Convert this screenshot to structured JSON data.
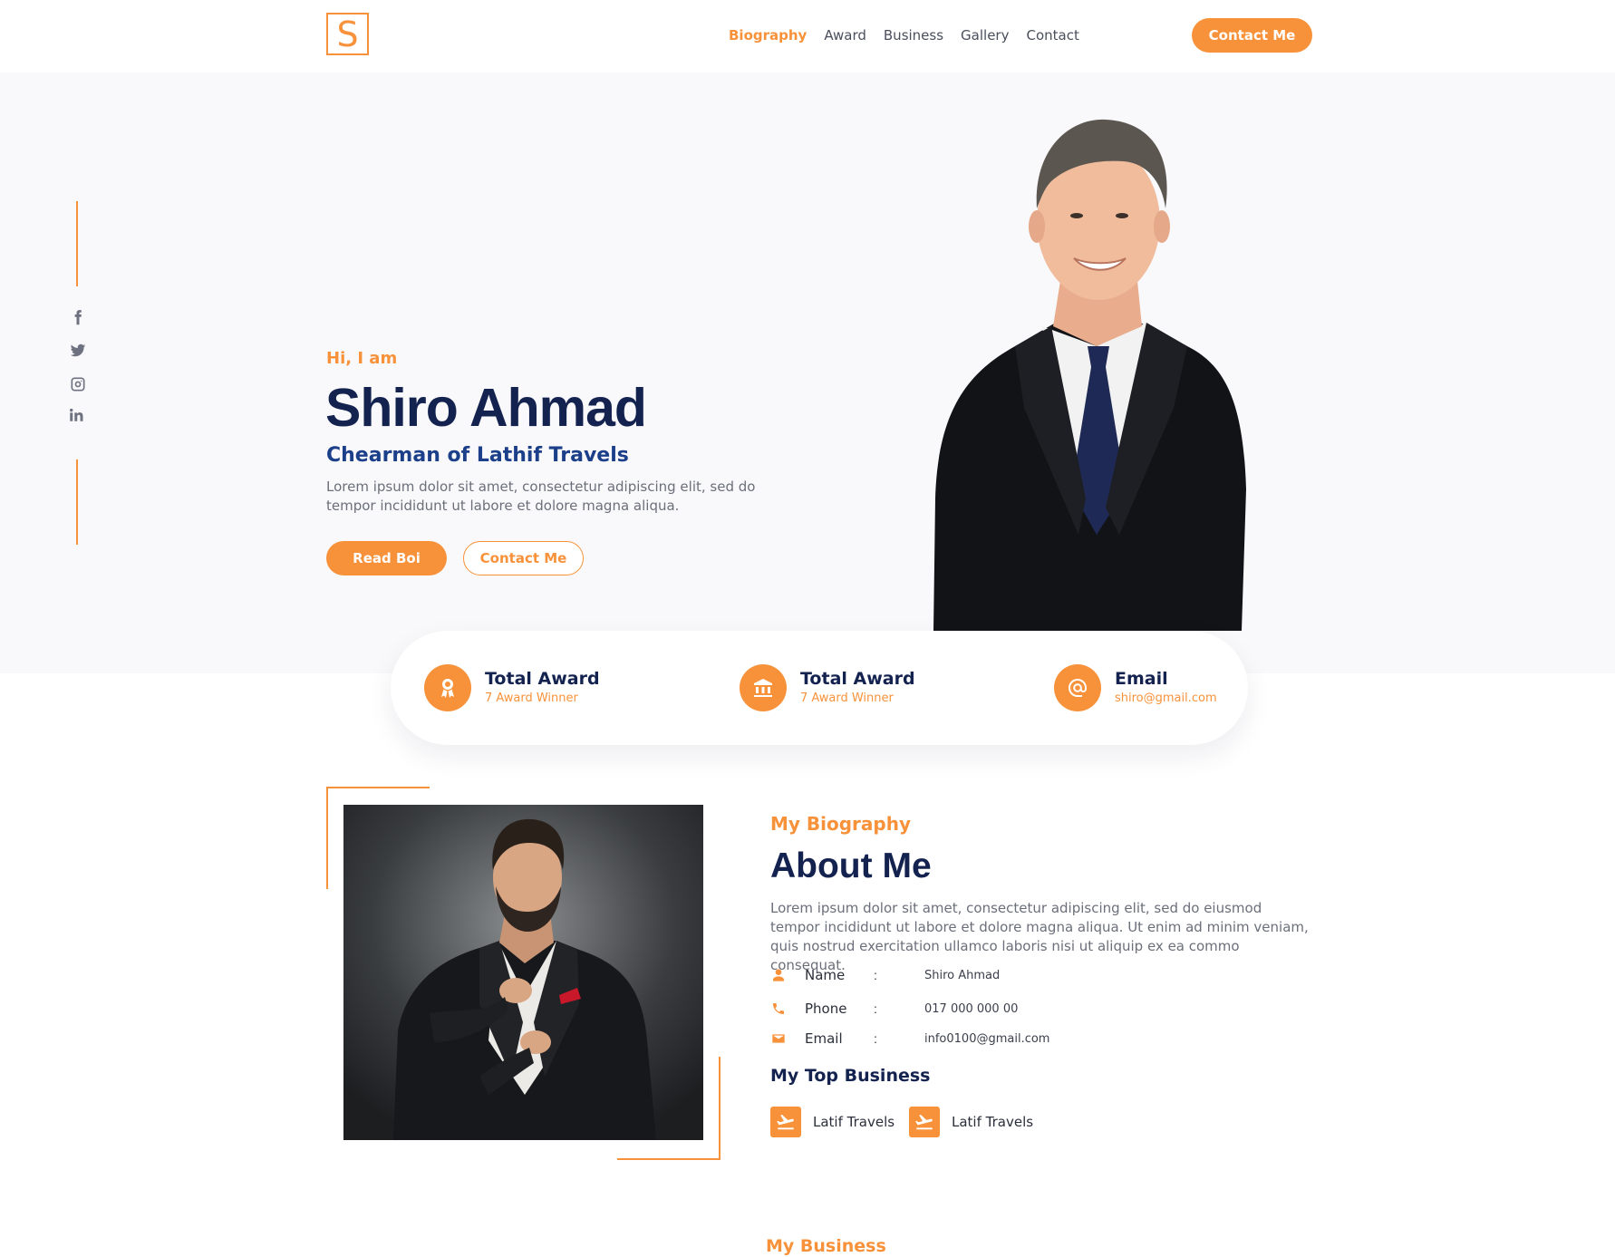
{
  "brand": {
    "logo_letter": "S",
    "accent_color": "#f7923a",
    "navy_color": "#13224f"
  },
  "nav": {
    "items": [
      {
        "label": "Biography",
        "active": true
      },
      {
        "label": "Award",
        "active": false
      },
      {
        "label": "Business",
        "active": false
      },
      {
        "label": "Gallery",
        "active": false
      },
      {
        "label": "Contact",
        "active": false
      }
    ],
    "cta_label": "Contact Me"
  },
  "social": {
    "icons": [
      "facebook-icon",
      "twitter-icon",
      "instagram-icon",
      "linkedin-icon"
    ]
  },
  "hero": {
    "greeting": "Hi, I am",
    "name": "Shiro Ahmad",
    "role": "Chearman of Lathif Travels",
    "description": "Lorem ipsum dolor sit amet, consectetur adipiscing elit, sed do tempor incididunt ut labore et dolore magna aliqua.",
    "primary_button": "Read Boi",
    "secondary_button": "Contact Me"
  },
  "stats": [
    {
      "icon": "award-icon",
      "title": "Total Award",
      "subtitle": "7 Award Winner"
    },
    {
      "icon": "bank-icon",
      "title": "Total Award",
      "subtitle": "7 Award Winner"
    },
    {
      "icon": "at-sign-icon",
      "title": "Email",
      "subtitle": "shiro@gmail.com"
    }
  ],
  "about": {
    "eyebrow": "My Biography",
    "title": "About Me",
    "description": "Lorem ipsum dolor sit amet, consectetur adipiscing elit, sed do eiusmod tempor incididunt ut labore et dolore magna aliqua. Ut enim ad minim veniam, quis nostrud exercitation ullamco laboris nisi ut aliquip ex ea commo consequat.",
    "info": [
      {
        "icon": "user-icon",
        "label": "Name",
        "separator": ":",
        "value": "Shiro Ahmad"
      },
      {
        "icon": "phone-icon",
        "label": "Phone",
        "separator": ":",
        "value": "017 000 000 00"
      },
      {
        "icon": "mail-icon",
        "label": "Email",
        "separator": ":",
        "value": "info0100@gmail.com"
      }
    ],
    "top_business_title": "My Top Business",
    "businesses": [
      {
        "icon": "plane-takeoff-icon",
        "label": "Latif Travels"
      },
      {
        "icon": "plane-takeoff-icon",
        "label": "Latif Travels"
      }
    ]
  },
  "next_section_eyebrow": "My Business"
}
